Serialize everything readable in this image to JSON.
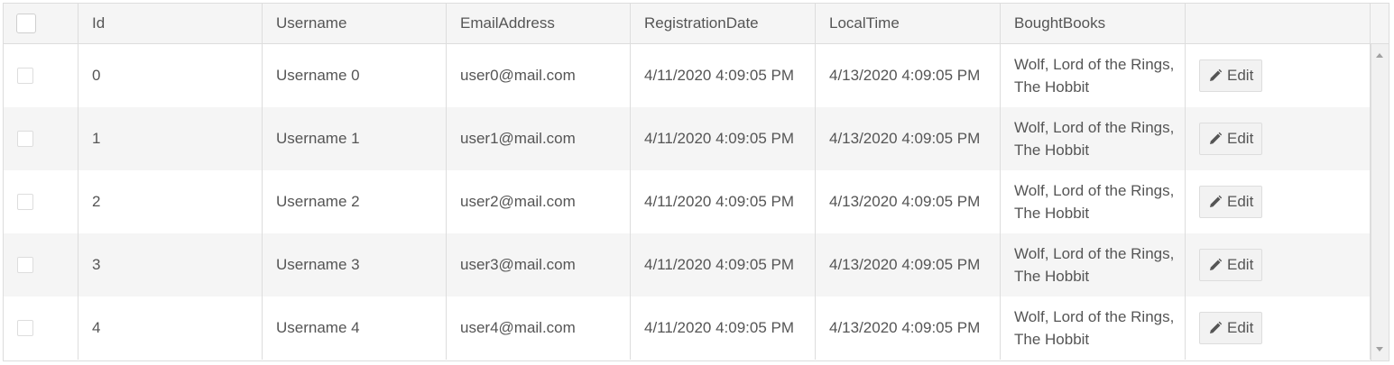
{
  "columns": {
    "id": "Id",
    "username": "Username",
    "email": "EmailAddress",
    "registration": "RegistrationDate",
    "localtime": "LocalTime",
    "books": "BoughtBooks",
    "actions": ""
  },
  "rows": [
    {
      "id": "0",
      "username": "Username 0",
      "email": "user0@mail.com",
      "registration": "4/11/2020 4:09:05 PM",
      "localtime": "4/13/2020 4:09:05 PM",
      "books": "Wolf, Lord of the Rings, The Hobbit",
      "edit_label": "Edit"
    },
    {
      "id": "1",
      "username": "Username 1",
      "email": "user1@mail.com",
      "registration": "4/11/2020 4:09:05 PM",
      "localtime": "4/13/2020 4:09:05 PM",
      "books": "Wolf, Lord of the Rings, The Hobbit",
      "edit_label": "Edit"
    },
    {
      "id": "2",
      "username": "Username 2",
      "email": "user2@mail.com",
      "registration": "4/11/2020 4:09:05 PM",
      "localtime": "4/13/2020 4:09:05 PM",
      "books": "Wolf, Lord of the Rings, The Hobbit",
      "edit_label": "Edit"
    },
    {
      "id": "3",
      "username": "Username 3",
      "email": "user3@mail.com",
      "registration": "4/11/2020 4:09:05 PM",
      "localtime": "4/13/2020 4:09:05 PM",
      "books": "Wolf, Lord of the Rings, The Hobbit",
      "edit_label": "Edit"
    },
    {
      "id": "4",
      "username": "Username 4",
      "email": "user4@mail.com",
      "registration": "4/11/2020 4:09:05 PM",
      "localtime": "4/13/2020 4:09:05 PM",
      "books": "Wolf, Lord of the Rings, The Hobbit",
      "edit_label": "Edit"
    }
  ],
  "icons": {
    "edit": "pencil-icon",
    "select_all": "checkbox",
    "scroll_up": "arrow-up-icon",
    "scroll_down": "arrow-down-icon"
  },
  "colors": {
    "header_bg": "#f5f5f5",
    "alt_row_bg": "#f5f5f5",
    "border": "#dddddd",
    "text": "#555555"
  }
}
